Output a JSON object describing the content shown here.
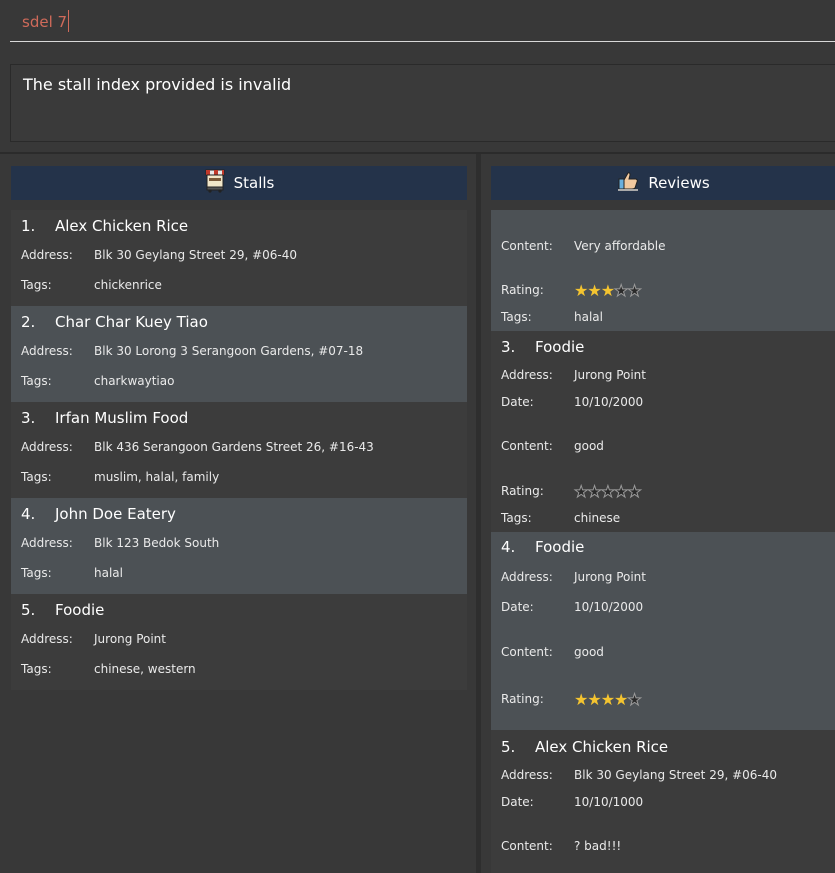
{
  "command": {
    "value": "sdel 7"
  },
  "result": {
    "message": "The stall index provided is invalid"
  },
  "stalls_panel": {
    "title": "Stalls",
    "icon": "stall-icon",
    "labels": {
      "address": "Address:",
      "tags": "Tags:"
    },
    "items": [
      {
        "index": "1.",
        "name": "Alex Chicken Rice",
        "address": "Blk 30 Geylang Street 29, #06-40",
        "tags": "chickenrice"
      },
      {
        "index": "2.",
        "name": "Char Char Kuey Tiao",
        "address": "Blk 30 Lorong 3 Serangoon Gardens, #07-18",
        "tags": "charkwaytiao"
      },
      {
        "index": "3.",
        "name": "Irfan Muslim Food",
        "address": "Blk 436 Serangoon Gardens Street 26, #16-43",
        "tags": "muslim, halal, family"
      },
      {
        "index": "4.",
        "name": "John Doe Eatery",
        "address": "Blk 123 Bedok South",
        "tags": "halal"
      },
      {
        "index": "5.",
        "name": "Foodie",
        "address": "Jurong Point",
        "tags": "chinese, western"
      }
    ]
  },
  "reviews_panel": {
    "title": "Reviews",
    "icon": "thumbs-up-icon",
    "labels": {
      "address": "Address:",
      "date": "Date:",
      "content": "Content:",
      "rating": "Rating:",
      "tags": "Tags:"
    },
    "partial_item": {
      "content": "Very affordable",
      "rating": 3,
      "tags": "halal"
    },
    "items": [
      {
        "index": "3.",
        "name": "Foodie",
        "address": "Jurong Point",
        "date": "10/10/2000",
        "content": "good",
        "rating": 0,
        "tags": "chinese"
      },
      {
        "index": "4.",
        "name": "Foodie",
        "address": "Jurong Point",
        "date": "10/10/2000",
        "content": "good",
        "rating": 4
      },
      {
        "index": "5.",
        "name": "Alex Chicken Rice",
        "address": "Blk 30 Geylang Street 29, #06-40",
        "date": "10/10/1000",
        "content": "? bad!!!"
      }
    ],
    "rating_max": 5
  },
  "colors": {
    "header_bg": "#24334a",
    "card_bg": "#3c3c3c",
    "card_alt_bg": "#4c5155",
    "command_text": "#cf6a5a",
    "star": "#f4c430"
  }
}
